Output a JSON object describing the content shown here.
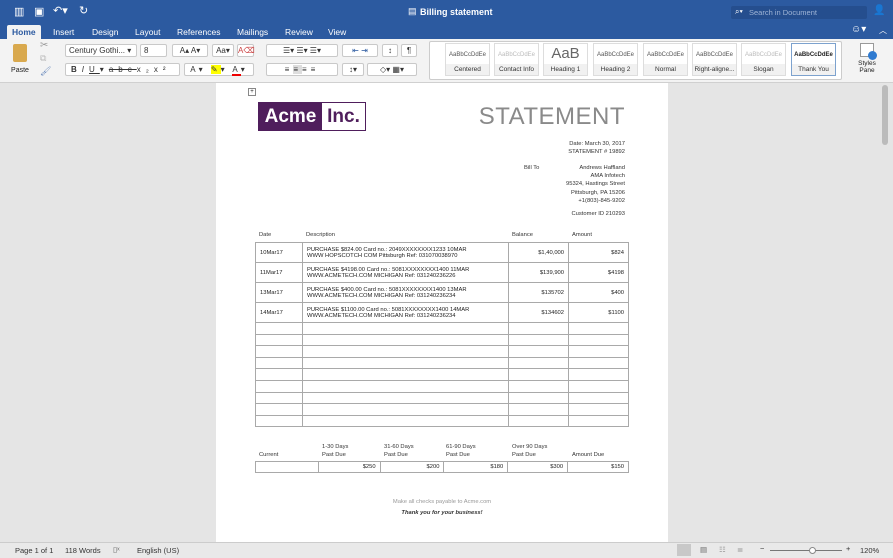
{
  "window": {
    "title": "Billing statement",
    "search_placeholder": "Search in Document"
  },
  "tabs": [
    "Home",
    "Insert",
    "Design",
    "Layout",
    "References",
    "Mailings",
    "Review",
    "View"
  ],
  "ribbon": {
    "paste_label": "Paste",
    "font_name": "Century Gothi...",
    "font_size": "8",
    "styles_pane_label": "Styles Pane",
    "styles": [
      {
        "name": "Centered",
        "preview": "AaBbCcDdEe"
      },
      {
        "name": "Contact Info",
        "preview": "AaBbCcDdEe"
      },
      {
        "name": "Heading 1",
        "preview": "AaB"
      },
      {
        "name": "Heading 2",
        "preview": "AaBbCcDdEe"
      },
      {
        "name": "Normal",
        "preview": "AaBbCcDdEe"
      },
      {
        "name": "Right-aligne...",
        "preview": "AaBbCcDdEe"
      },
      {
        "name": "Slogan",
        "preview": "AaBbCcDdEe"
      },
      {
        "name": "Thank You",
        "preview": "AaBbCcDdEe"
      }
    ],
    "selected_style": "Thank You"
  },
  "document": {
    "logo": {
      "left": "Acme",
      "right": "Inc.",
      "color": "#4f1e5c"
    },
    "title": "STATEMENT",
    "date": "Date: March 30, 2017",
    "statement_no": "STATEMENT # 19892",
    "bill_to_label": "Bill To",
    "bill_to": [
      "Andrews Haffland",
      "AMA Infotech",
      "95324, Hastings Street",
      "Pittsburgh, PA 15206",
      "+1(803)-845-9202"
    ],
    "customer_id": "Customer ID 210293",
    "columns": [
      "Date",
      "Description",
      "Balance",
      "Amount"
    ],
    "rows": [
      {
        "date": "10Mar17",
        "desc1": "PURCHASE $824.00 Card no.: 2049XXXXXXXX1233 10MAR",
        "desc2": "WWW HOPSCOTCH COM Pittsburgh Ref: 031070038970",
        "balance": "$1,40,000",
        "amount": "$824"
      },
      {
        "date": "11Mar17",
        "desc1": "PURCHASE $4198.00 Card no.: 5081XXXXXXXX1400 11MAR",
        "desc2": "WWW.ACMETECH.COM MICHIGAN Ref: 031240236226",
        "balance": "$139,900",
        "amount": "$4198"
      },
      {
        "date": "13Mar17",
        "desc1": "PURCHASE $400.00 Card no.: 5081XXXXXXXX1400 13MAR",
        "desc2": "WWW.ACMETECH.COM MICHIGAN Ref: 031240236234",
        "balance": "$135702",
        "amount": "$400"
      },
      {
        "date": "14Mar17",
        "desc1": "PURCHASE $1100.00 Card no.: 5081XXXXXXXX1400 14MAR",
        "desc2": "WWW.ACMETECH.COM MICHIGAN Ref: 031240236234",
        "balance": "$134602",
        "amount": "$1100"
      }
    ],
    "aging_headers": [
      [
        "",
        "Current"
      ],
      [
        "1-30 Days",
        "Past Due"
      ],
      [
        "31-60 Days",
        "Past Due"
      ],
      [
        "61-90 Days",
        "Past Due"
      ],
      [
        "Over 90 Days",
        "Past Due"
      ],
      [
        "",
        "Amount Due"
      ]
    ],
    "aging_values": [
      "",
      "$250",
      "$200",
      "$180",
      "$300",
      "$150"
    ],
    "footer_note": "Make all checks payable to Acme.com",
    "thanks": "Thank you for your business!"
  },
  "status": {
    "page": "Page 1 of 1",
    "words": "118 Words",
    "language": "English (US)",
    "zoom": "120%",
    "zoom_level": 0.6
  }
}
